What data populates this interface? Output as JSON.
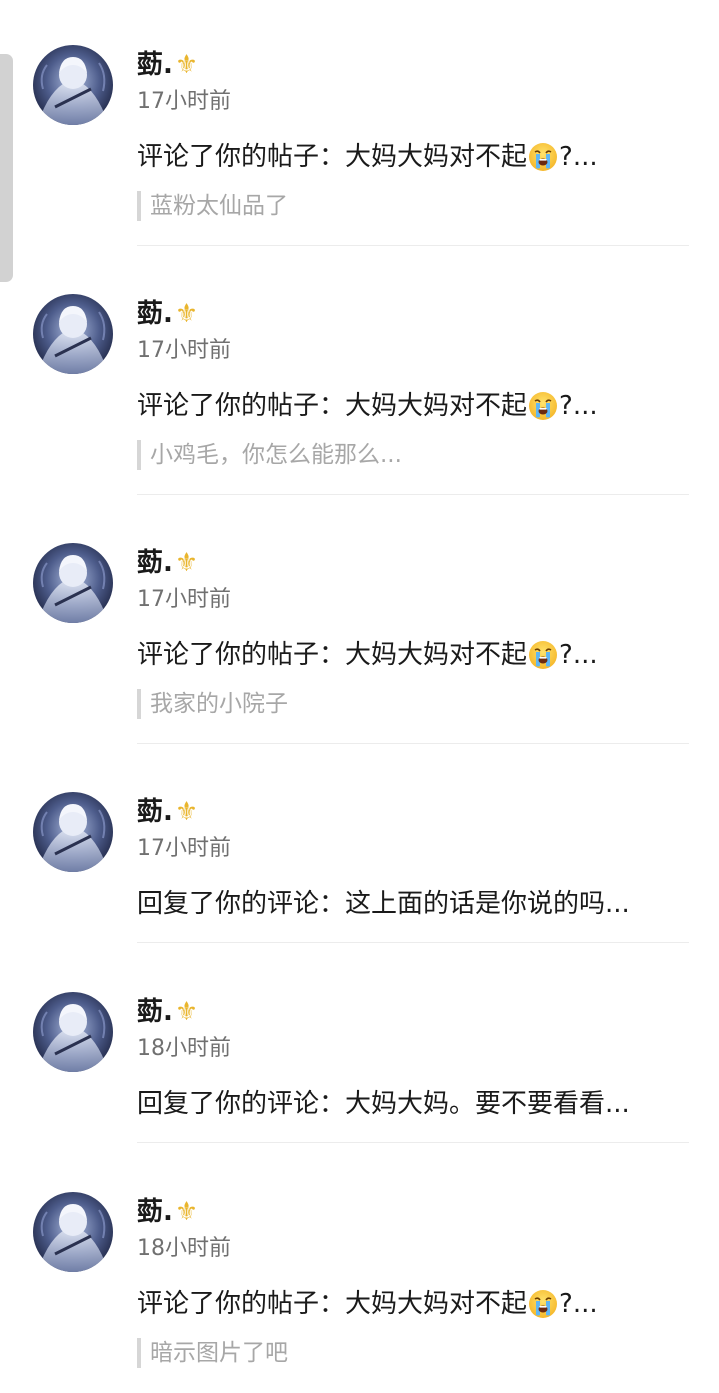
{
  "notifications": [
    {
      "username": "葝.",
      "badge_icon": "fleur-de-lis-icon",
      "time": "17小时前",
      "action_prefix": "评论了你的帖子：大妈大妈对不起",
      "emoji": "loudly-crying-face-icon",
      "action_suffix": "?...",
      "quote": "蓝粉太仙品了"
    },
    {
      "username": "葝.",
      "badge_icon": "fleur-de-lis-icon",
      "time": "17小时前",
      "action_prefix": "评论了你的帖子：大妈大妈对不起",
      "emoji": "loudly-crying-face-icon",
      "action_suffix": "?...",
      "quote": "小鸡毛，你怎么能那么..."
    },
    {
      "username": "葝.",
      "badge_icon": "fleur-de-lis-icon",
      "time": "17小时前",
      "action_prefix": "评论了你的帖子：大妈大妈对不起",
      "emoji": "loudly-crying-face-icon",
      "action_suffix": "?...",
      "quote": "我家的小院子"
    },
    {
      "username": "葝.",
      "badge_icon": "fleur-de-lis-icon",
      "time": "17小时前",
      "action_prefix": "回复了你的评论：这上面的话是你说的吗...",
      "emoji": "",
      "action_suffix": "",
      "quote": ""
    },
    {
      "username": "葝.",
      "badge_icon": "fleur-de-lis-icon",
      "time": "18小时前",
      "action_prefix": "回复了你的评论：大妈大妈。要不要看看...",
      "emoji": "",
      "action_suffix": "",
      "quote": ""
    },
    {
      "username": "葝.",
      "badge_icon": "fleur-de-lis-icon",
      "time": "18小时前",
      "action_prefix": "评论了你的帖子：大妈大妈对不起",
      "emoji": "loudly-crying-face-icon",
      "action_suffix": "?...",
      "quote": "暗示图片了吧"
    }
  ],
  "colors": {
    "background": "#ffffff",
    "text_primary": "#1a1a1a",
    "text_secondary": "#707070",
    "quote_text": "#a7a7a7",
    "badge_gold": "#e9b52d"
  }
}
